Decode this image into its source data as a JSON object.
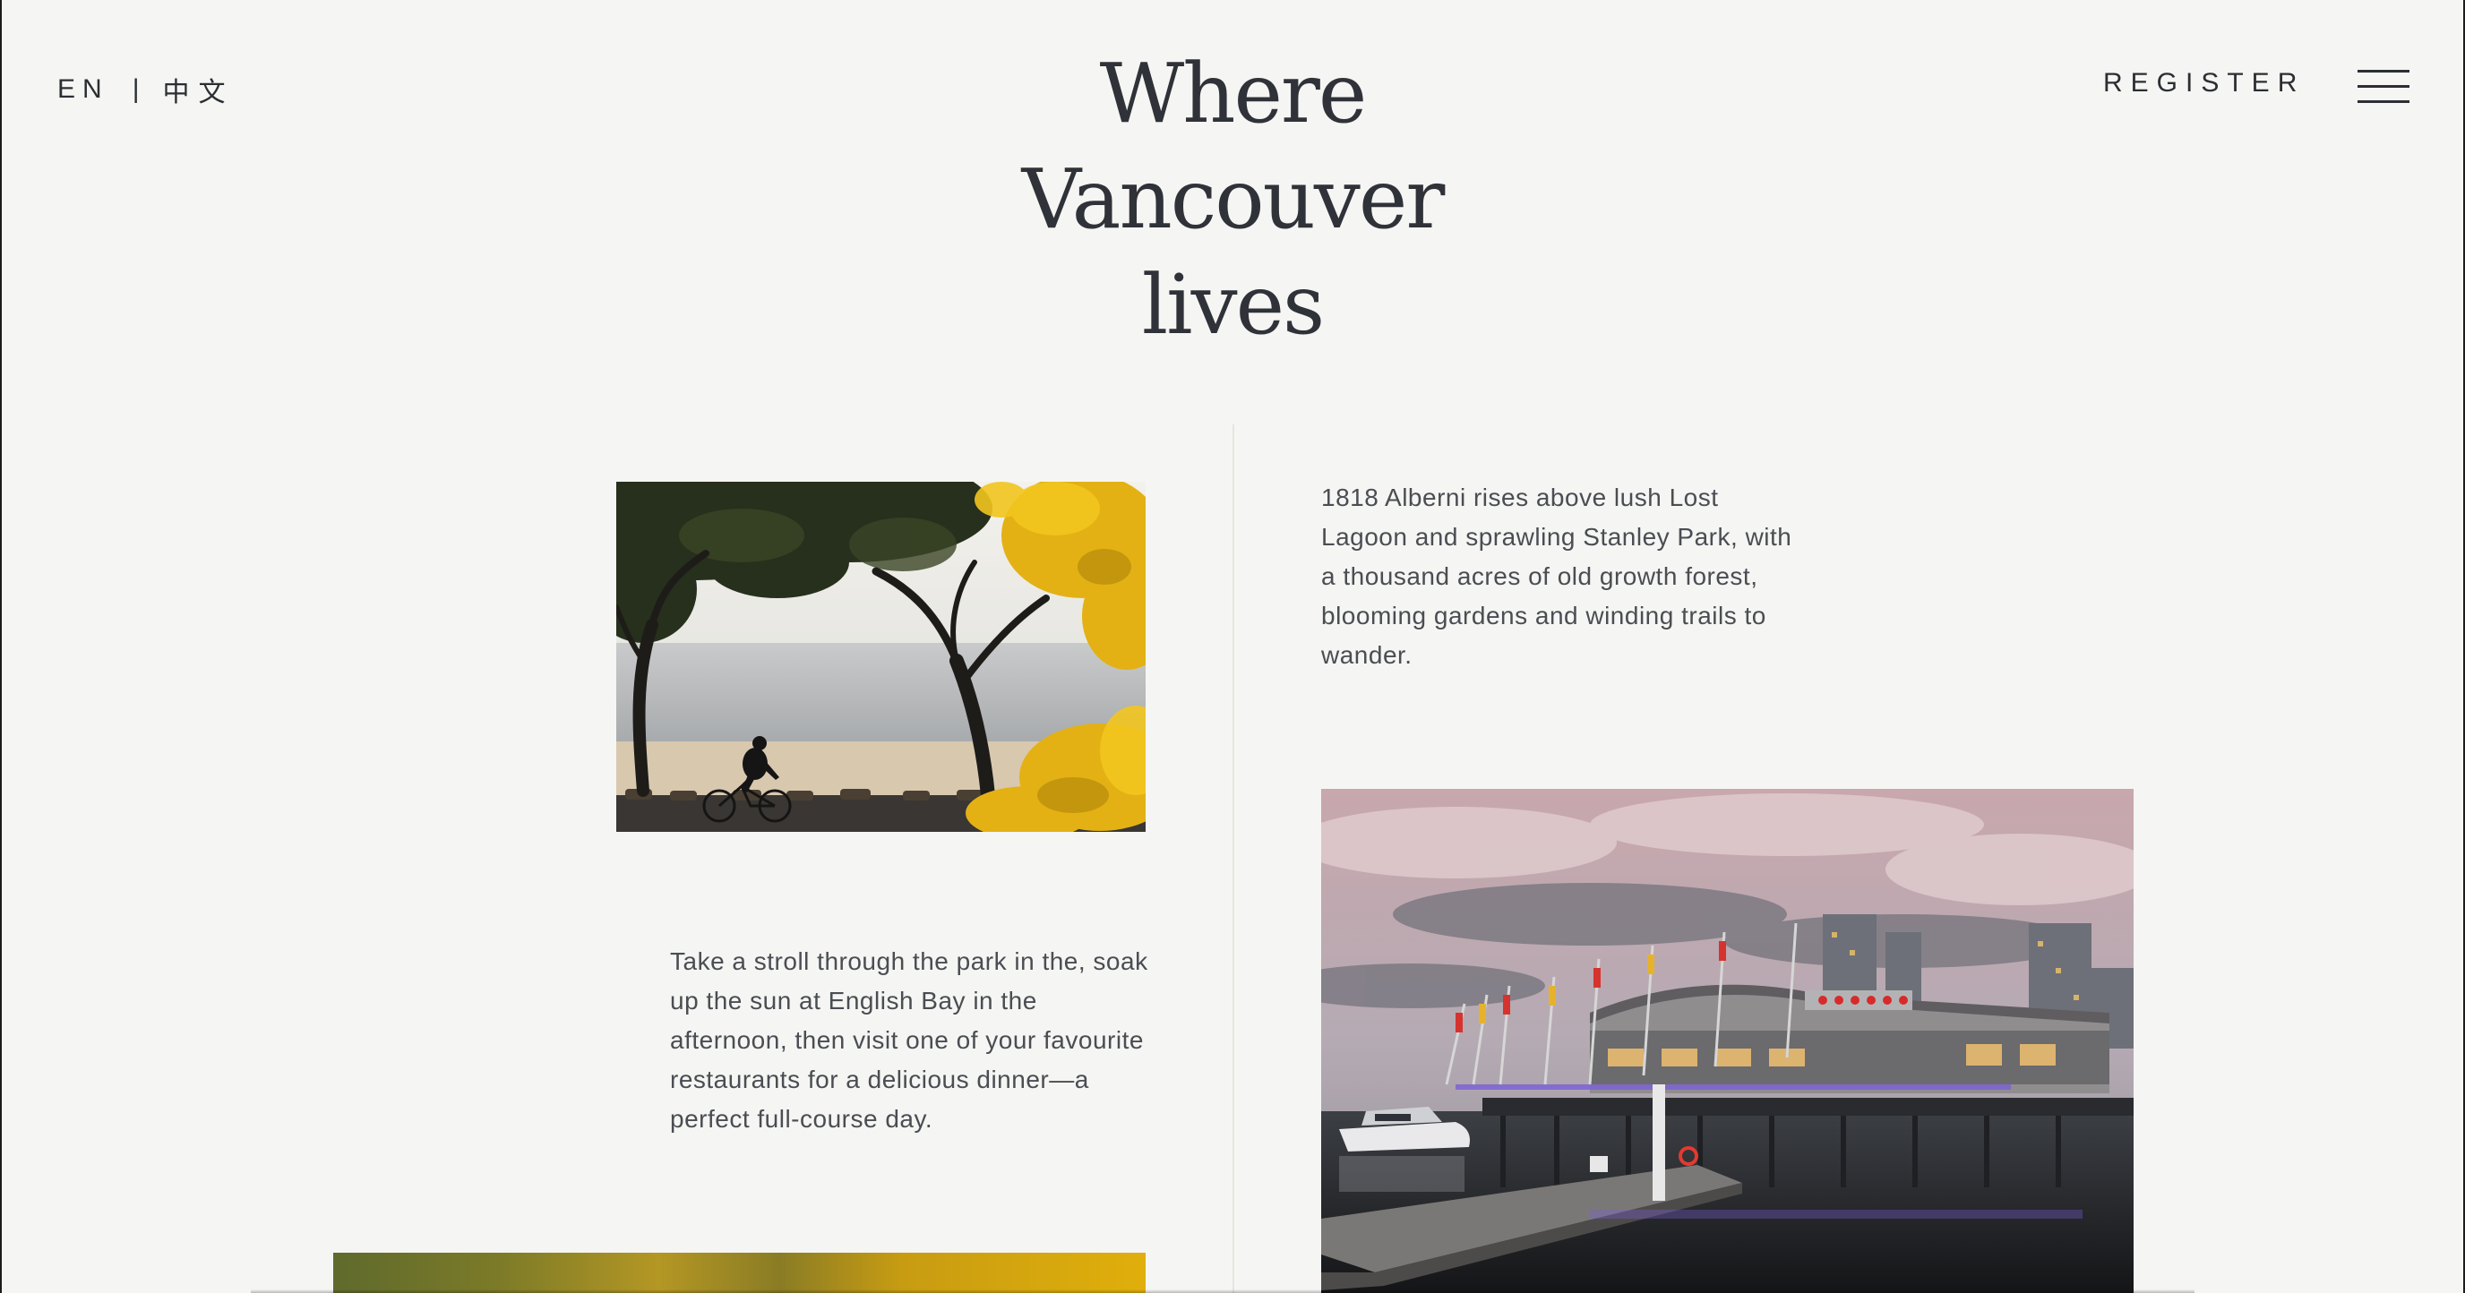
{
  "header": {
    "lang_en": "EN",
    "lang_separator": "|",
    "lang_zh": "中文",
    "register_label": "REGISTER",
    "menu_icon": "hamburger-menu-icon"
  },
  "hero": {
    "title_lines": [
      "Where",
      "Vancouver",
      "lives"
    ]
  },
  "content": {
    "paragraph_right": "1818 Alberni rises above lush Lost Lagoon and sprawling Stanley Park, with a thousand acres of old growth forest, blooming gardens and winding trails to wander.",
    "paragraph_left": "Take a stroll through the park in the, soak up the sun at English Bay in the afternoon, then visit one of your favourite restaurants for a delicious dinner—a perfect full-course day."
  },
  "colors": {
    "background": "#f5f5f3",
    "text": "#2f3238",
    "accent_yellow": "#e0af0b"
  }
}
